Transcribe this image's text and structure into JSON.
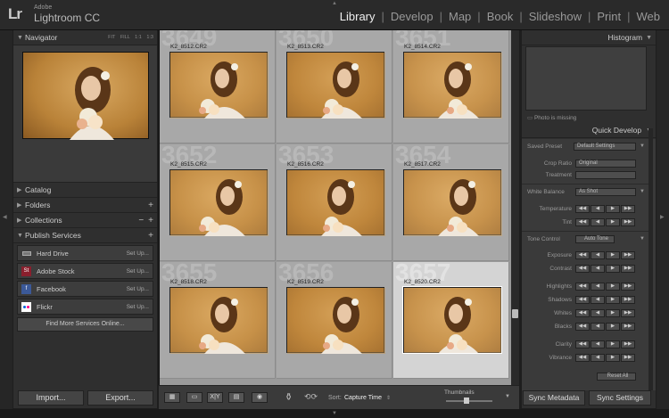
{
  "app": {
    "logo": "Lr",
    "brand_small": "Adobe",
    "brand": "Lightroom CC"
  },
  "modules": [
    {
      "label": "Library",
      "active": true
    },
    {
      "label": "Develop",
      "active": false
    },
    {
      "label": "Map",
      "active": false
    },
    {
      "label": "Book",
      "active": false
    },
    {
      "label": "Slideshow",
      "active": false
    },
    {
      "label": "Print",
      "active": false
    },
    {
      "label": "Web",
      "active": false
    }
  ],
  "navigator": {
    "title": "Navigator",
    "options": [
      "FIT",
      "FILL",
      "1:1",
      "1:3"
    ]
  },
  "left_panels": [
    "Catalog",
    "Folders",
    "Collections"
  ],
  "publish": {
    "title": "Publish Services",
    "services": [
      {
        "name": "Hard Drive",
        "action": "Set Up...",
        "icon": "hard-drive-icon",
        "color": "#777777",
        "glyph": ""
      },
      {
        "name": "Adobe Stock",
        "action": "Set Up...",
        "icon": "adobe-stock-icon",
        "color": "#8a1f2d",
        "glyph": "St"
      },
      {
        "name": "Facebook",
        "action": "Set Up...",
        "icon": "facebook-icon",
        "color": "#3b5998",
        "glyph": "f"
      },
      {
        "name": "Flickr",
        "action": "Set Up...",
        "icon": "flickr-icon",
        "color": "#ffffff",
        "glyph": ""
      }
    ],
    "find_more": "Find More Services Online..."
  },
  "left_buttons": {
    "import": "Import...",
    "export": "Export..."
  },
  "grid": {
    "cells": [
      {
        "index": "3649",
        "filename": "K2_8512.CR2",
        "selected": false
      },
      {
        "index": "3650",
        "filename": "K2_8513.CR2",
        "selected": false
      },
      {
        "index": "3651",
        "filename": "K2_8514.CR2",
        "selected": false
      },
      {
        "index": "3652",
        "filename": "K2_8515.CR2",
        "selected": false
      },
      {
        "index": "3653",
        "filename": "K2_8516.CR2",
        "selected": false
      },
      {
        "index": "3654",
        "filename": "K2_8517.CR2",
        "selected": false
      },
      {
        "index": "3655",
        "filename": "K2_8518.CR2",
        "selected": false
      },
      {
        "index": "3656",
        "filename": "K2_8519.CR2",
        "selected": false
      },
      {
        "index": "3657",
        "filename": "K2_8520.CR2",
        "selected": true
      }
    ]
  },
  "toolbar": {
    "sort_label": "Sort:",
    "sort_value": "Capture Time",
    "thumbnails_label": "Thumbnails",
    "view_buttons": [
      "grid-view-icon",
      "loupe-view-icon",
      "compare-view-icon",
      "survey-view-icon",
      "people-view-icon"
    ],
    "compare_text": "X|Y"
  },
  "histogram": {
    "title": "Histogram",
    "missing": "Photo is missing"
  },
  "quick_develop": {
    "title": "Quick Develop",
    "saved_preset_label": "Saved Preset",
    "saved_preset_value": "Default Settings",
    "crop_label": "Crop Ratio",
    "crop_value": "Original",
    "treatment_label": "Treatment",
    "treatment_value": "",
    "wb_label": "White Balance",
    "wb_value": "As Shot",
    "temperature_label": "Temperature",
    "tint_label": "Tint",
    "tone_label": "Tone Control",
    "auto_tone": "Auto Tone",
    "exposure_label": "Exposure",
    "contrast_label": "Contrast",
    "highlights_label": "Highlights",
    "shadows_label": "Shadows",
    "whites_label": "Whites",
    "blacks_label": "Blacks",
    "clarity_label": "Clarity",
    "vibrance_label": "Vibrance",
    "reset_all": "Reset All",
    "step_buttons": [
      "◀◀",
      "◀",
      "▶",
      "▶▶"
    ]
  },
  "right_buttons": {
    "sync_metadata": "Sync Metadata",
    "sync_settings": "Sync Settings"
  }
}
